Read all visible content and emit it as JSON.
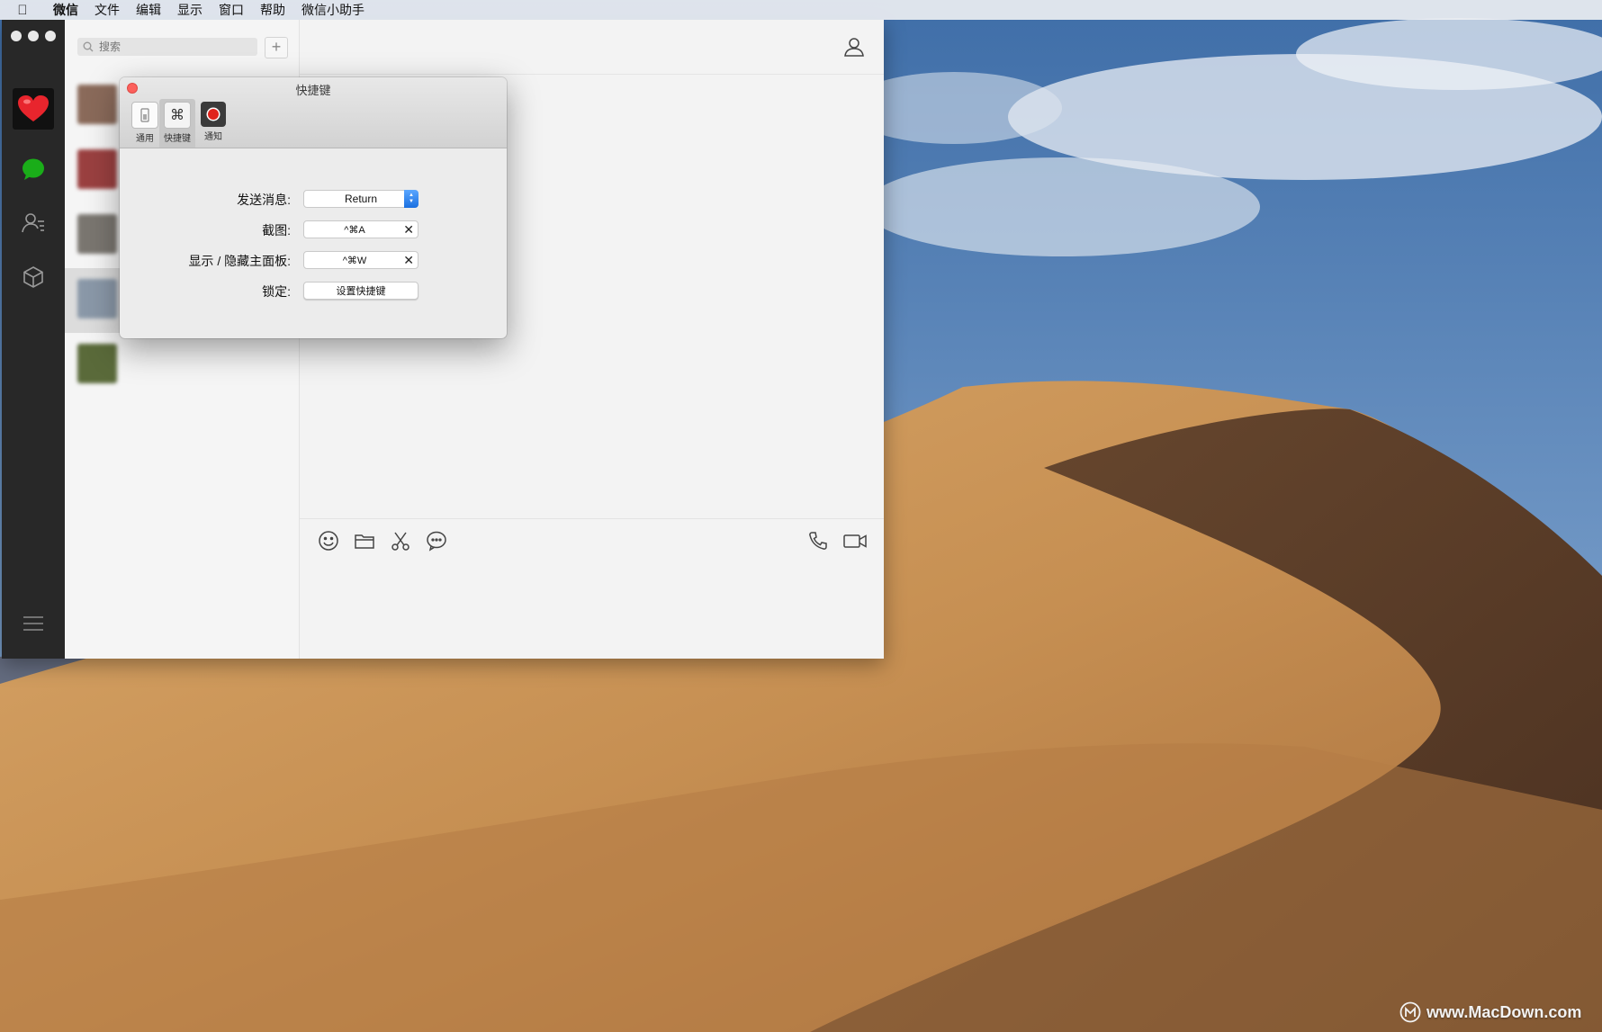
{
  "menubar": {
    "apple_icon": "apple-logo",
    "items": [
      "微信",
      "文件",
      "编辑",
      "显示",
      "窗口",
      "帮助",
      "微信小助手"
    ]
  },
  "main_window": {
    "nav_icons": [
      "heart-avatar-icon",
      "chat-bubble-icon",
      "contacts-icon",
      "favorites-cube-icon",
      "menu-icon"
    ],
    "search": {
      "placeholder": "搜索",
      "add_label": "+"
    },
    "conversations": [
      {
        "name": "",
        "selected": false,
        "color": "#8a6a5a"
      },
      {
        "name": "",
        "selected": false,
        "color": "#9a4040"
      },
      {
        "name": "",
        "selected": false,
        "color": "#7a7670"
      },
      {
        "name": "",
        "selected": true,
        "color": "#8a98a8"
      },
      {
        "name": "",
        "selected": false,
        "color": "#5a6a3a"
      }
    ],
    "chat": {
      "title": "",
      "toolbar_icons": [
        "emoji-icon",
        "folder-icon",
        "scissors-icon",
        "chat-history-icon",
        "phone-icon",
        "video-icon"
      ]
    }
  },
  "prefs": {
    "title": "快捷键",
    "tabs": [
      {
        "label": "通用",
        "icon": "switch-icon",
        "active": false
      },
      {
        "label": "快捷键",
        "icon": "command-icon",
        "active": true
      },
      {
        "label": "通知",
        "icon": "record-icon",
        "active": false
      }
    ],
    "rows": [
      {
        "label": "发送消息:",
        "value": "Return",
        "type": "select"
      },
      {
        "label": "截图:",
        "value": "^⌘A",
        "type": "shortcut"
      },
      {
        "label": "显示 / 隐藏主面板:",
        "value": "^⌘W",
        "type": "shortcut"
      },
      {
        "label": "锁定:",
        "value": "设置快捷键",
        "type": "button"
      }
    ],
    "clear_label": "✕"
  },
  "watermark": {
    "text": "www.MacDown.com"
  }
}
